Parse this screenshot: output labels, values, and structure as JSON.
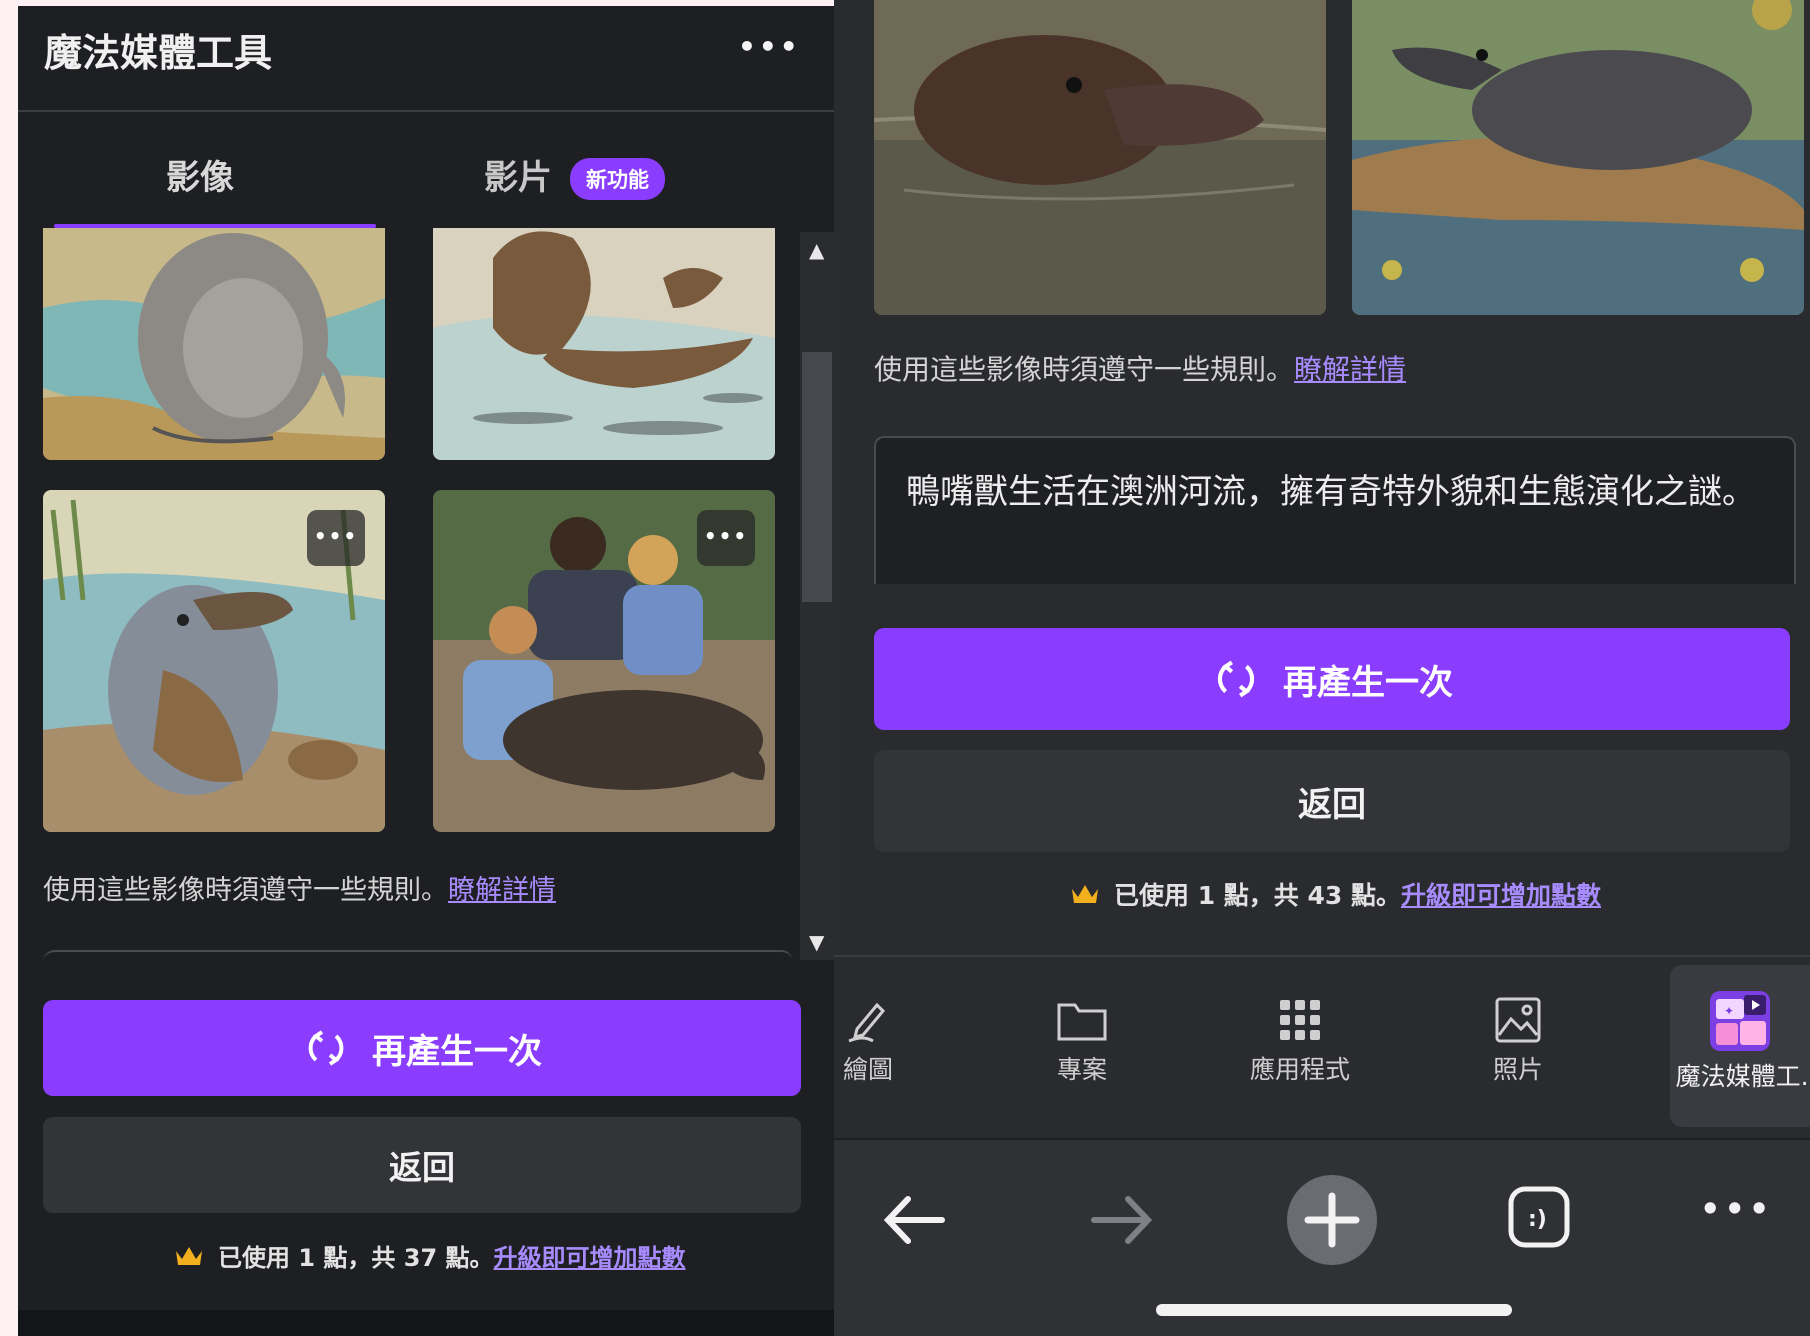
{
  "left_panel": {
    "title": "魔法媒體工具",
    "more_label": "•••",
    "tabs": [
      {
        "label": "影像",
        "active": true
      },
      {
        "label": "影片",
        "badge": "新功能"
      }
    ],
    "rules_text": "使用這些影像時須遵守一些規則。",
    "rules_link": "瞭解詳情",
    "regenerate_label": "再產生一次",
    "back_label": "返回",
    "usage_text": "已使用 1 點，共 37 點。",
    "usage_link": "升級即可增加點數",
    "thumb_menu": "•••"
  },
  "right_panel": {
    "rules_text": "使用這些影像時須遵守一些規則。",
    "rules_link": "瞭解詳情",
    "prompt_text": "鴨嘴獸生活在澳洲河流，擁有奇特外貌和生態演化之謎。",
    "regenerate_label": "再產生一次",
    "back_label": "返回",
    "usage_text": "已使用 1 點，共 43 點。",
    "usage_link": "升級即可增加點數",
    "nav": [
      {
        "label": "繪圖",
        "icon": "draw-icon"
      },
      {
        "label": "專案",
        "icon": "folder-icon"
      },
      {
        "label": "應用程式",
        "icon": "apps-grid-icon"
      },
      {
        "label": "照片",
        "icon": "photo-icon"
      },
      {
        "label": "魔法媒體工...",
        "icon": "magic-media-icon",
        "active": true
      }
    ],
    "browser_bar": {
      "more_label": "•••"
    }
  },
  "colors": {
    "accent": "#8b3dff",
    "link": "#a78bff",
    "panel_bg": "#1e1f22",
    "crown": "#f2b01e"
  }
}
